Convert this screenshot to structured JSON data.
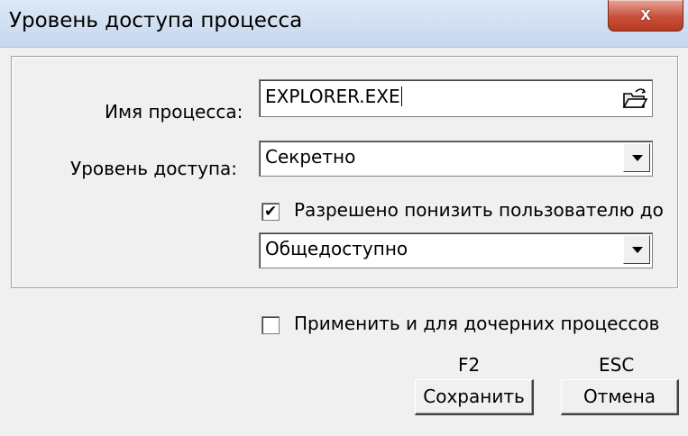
{
  "window": {
    "title": "Уровень доступа процесса",
    "close_label": "x"
  },
  "form": {
    "process_name_label": "Имя процесса:",
    "process_name_value": "EXPLORER.EXE",
    "access_level_label": "Уровень доступа:",
    "access_level_value": "Секретно",
    "allow_lower_label": "Разрешено понизить пользователю до",
    "allow_lower_checked": true,
    "lower_level_value": "Общедоступно"
  },
  "footer": {
    "apply_children_label": "Применить и для дочерних процессов",
    "apply_children_checked": false,
    "save_hotkey": "F2",
    "save_label": "Сохранить",
    "cancel_hotkey": "ESC",
    "cancel_label": "Отмена"
  },
  "icons": {
    "browse": "open-folder-icon",
    "dropdown": "chevron-down-icon"
  }
}
